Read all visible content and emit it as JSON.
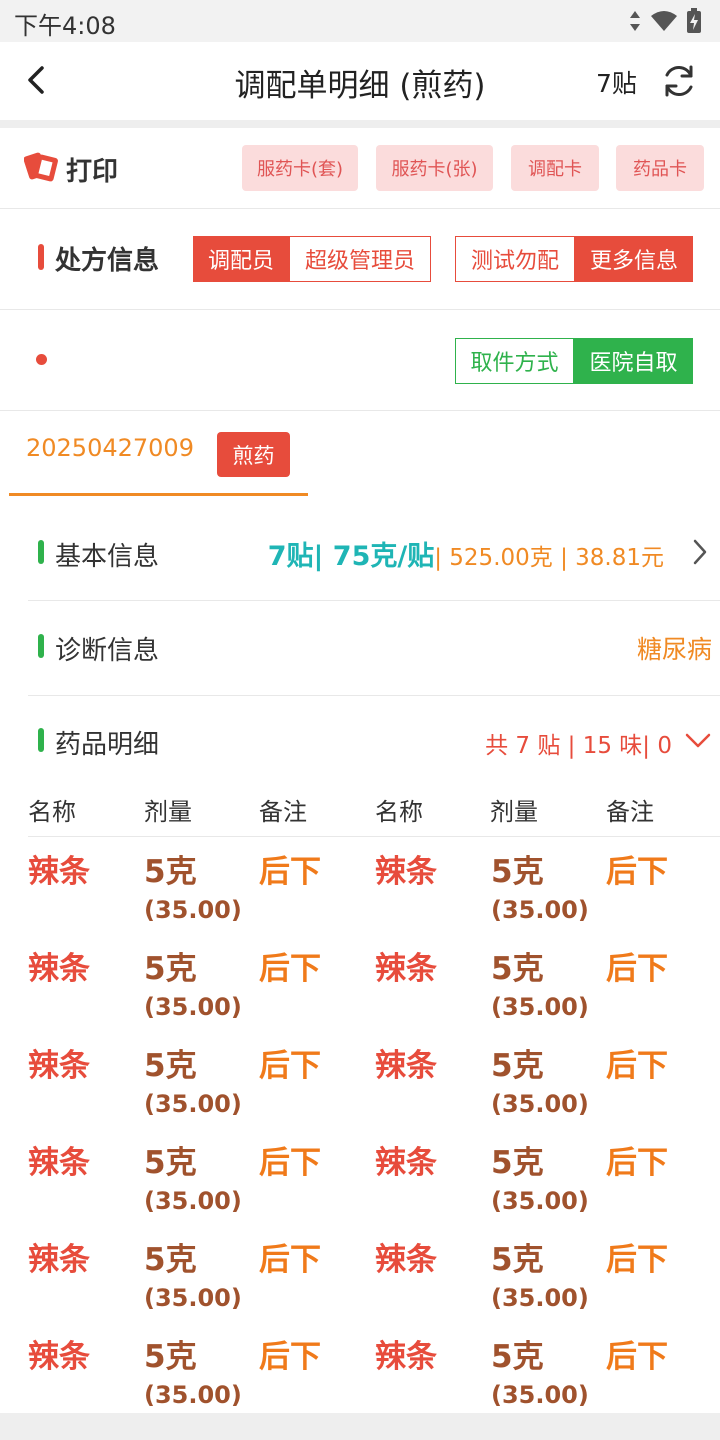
{
  "status": {
    "time": "下午4:08"
  },
  "nav": {
    "title": "调配单明细 (煎药)",
    "count": "7贴"
  },
  "print": {
    "label": "打印",
    "buttons": [
      "服药卡(套)",
      "服药卡(张)",
      "调配卡",
      "药品卡"
    ]
  },
  "prescription": {
    "title": "处方信息",
    "role_label": "调配员",
    "role_value": "超级管理员",
    "test_label": "测试勿配",
    "more_label": "更多信息"
  },
  "pickup": {
    "label": "取件方式",
    "value": "医院自取"
  },
  "order": {
    "number": "20250427009",
    "badge": "煎药"
  },
  "basic": {
    "title": "基本信息",
    "summary": "7贴| 75克/贴",
    "detail": "| 525.00克 | 38.81元"
  },
  "diagnosis": {
    "title": "诊断信息",
    "value": "糖尿病"
  },
  "medicines": {
    "title": "药品明细",
    "summary": "共 7 贴 | 15 味| 0",
    "headers": [
      "名称",
      "剂量",
      "备注",
      "名称",
      "剂量",
      "备注"
    ],
    "rows": [
      [
        {
          "name": "辣条",
          "dose": "5克",
          "price": "(35.00)",
          "note": "后下"
        },
        {
          "name": "辣条",
          "dose": "5克",
          "price": "(35.00)",
          "note": "后下"
        }
      ],
      [
        {
          "name": "辣条",
          "dose": "5克",
          "price": "(35.00)",
          "note": "后下"
        },
        {
          "name": "辣条",
          "dose": "5克",
          "price": "(35.00)",
          "note": "后下"
        }
      ],
      [
        {
          "name": "辣条",
          "dose": "5克",
          "price": "(35.00)",
          "note": "后下"
        },
        {
          "name": "辣条",
          "dose": "5克",
          "price": "(35.00)",
          "note": "后下"
        }
      ],
      [
        {
          "name": "辣条",
          "dose": "5克",
          "price": "(35.00)",
          "note": "后下"
        },
        {
          "name": "辣条",
          "dose": "5克",
          "price": "(35.00)",
          "note": "后下"
        }
      ],
      [
        {
          "name": "辣条",
          "dose": "5克",
          "price": "(35.00)",
          "note": "后下"
        },
        {
          "name": "辣条",
          "dose": "5克",
          "price": "(35.00)",
          "note": "后下"
        }
      ],
      [
        {
          "name": "辣条",
          "dose": "5克",
          "price": "(35.00)",
          "note": "后下"
        },
        {
          "name": "辣条",
          "dose": "5克",
          "price": "(35.00)",
          "note": "后下"
        }
      ]
    ]
  },
  "colors": {
    "accent_red": "#e74c3c",
    "accent_orange": "#f08a24",
    "accent_green": "#2fb24c",
    "teal": "#1fb5b5",
    "pink_button": "#fbdcdc"
  },
  "icons": {
    "back": "chevron-left-icon",
    "refresh": "refresh-icon",
    "print": "print-icon",
    "expand_right": "chevron-right-icon",
    "expand_down": "chevron-down-icon"
  }
}
